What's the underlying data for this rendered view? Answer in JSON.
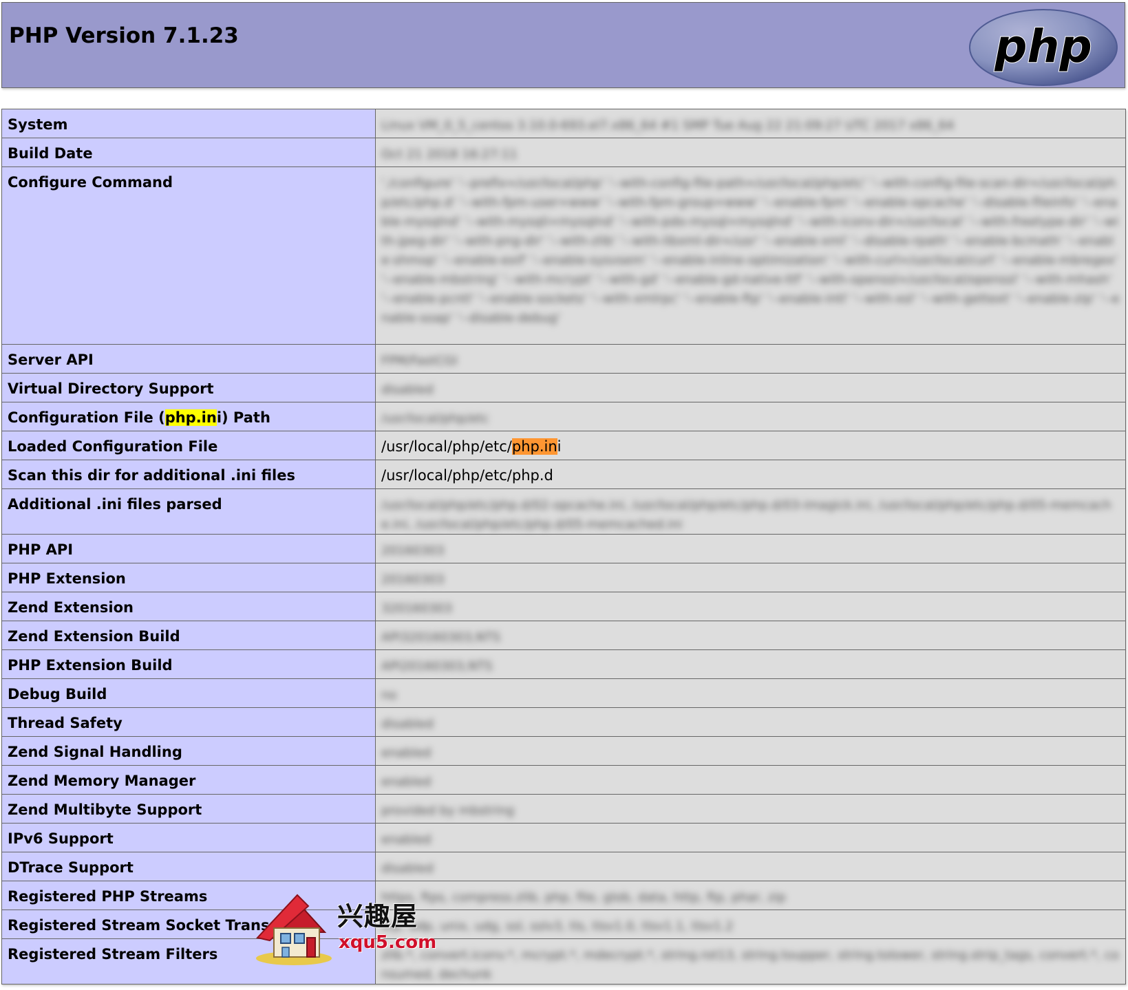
{
  "header": {
    "title": "PHP Version 7.1.23",
    "logo_text": "php",
    "logo_color": "#6f7fba"
  },
  "rows": [
    {
      "label": "System",
      "value": "Linux VM_0_5_centos 3.10.0-693.el7.x86_64 #1 SMP Tue Aug 22 21:09:27 UTC 2017 x86_64",
      "blurred": true
    },
    {
      "label": "Build Date",
      "value": "Oct 21 2018 16:27:11",
      "blurred": true
    },
    {
      "label": "Configure Command",
      "value": "'./configure' '--prefix=/usr/local/php' '--with-config-file-path=/usr/local/php/etc' '--with-config-file-scan-dir=/usr/local/php/etc/php.d' '--with-fpm-user=www' '--with-fpm-group=www' '--enable-fpm' '--enable-opcache' '--disable-fileinfo' '--enable-mysqlnd' '--with-mysqli=mysqlnd' '--with-pdo-mysql=mysqlnd' '--with-iconv-dir=/usr/local' '--with-freetype-dir' '--with-jpeg-dir' '--with-png-dir' '--with-zlib' '--with-libxml-dir=/usr' '--enable-xml' '--disable-rpath' '--enable-bcmath' '--enable-shmop' '--enable-exif' '--enable-sysvsem' '--enable-inline-optimization' '--with-curl=/usr/local/curl' '--enable-mbregex' '--enable-mbstring' '--with-mcrypt' '--with-gd' '--enable-gd-native-ttf' '--with-openssl=/usr/local/openssl' '--with-mhash' '--enable-pcntl' '--enable-sockets' '--with-xmlrpc' '--enable-ftp' '--enable-intl' '--with-xsl' '--with-gettext' '--enable-zip' '--enable-soap' '--disable-debug'",
      "blurred": true
    },
    {
      "label": "Server API",
      "value": "FPM/FastCGI",
      "blurred": true
    },
    {
      "label": "Virtual Directory Support",
      "value": "disabled",
      "blurred": true
    },
    {
      "label_pre": "Configuration File (",
      "label_hl": "php.in",
      "label_post": "i) Path",
      "value": "/usr/local/php/etc",
      "blurred": true
    },
    {
      "label": "Loaded Configuration File",
      "value_pre": "/usr/local/php/etc/",
      "value_hl": "php.in",
      "value_post": "i",
      "blurred": false
    },
    {
      "label": "Scan this dir for additional .ini files",
      "value": "/usr/local/php/etc/php.d",
      "blurred": false
    },
    {
      "label": "Additional .ini files parsed",
      "value": "/usr/local/php/etc/php.d/02-opcache.ini, /usr/local/php/etc/php.d/03-imagick.ini, /usr/local/php/etc/php.d/05-memcache.ini, /usr/local/php/etc/php.d/05-memcached.ini",
      "blurred": true
    },
    {
      "label": "PHP API",
      "value": "20160303",
      "blurred": true
    },
    {
      "label": "PHP Extension",
      "value": "20160303",
      "blurred": true
    },
    {
      "label": "Zend Extension",
      "value": "320160303",
      "blurred": true
    },
    {
      "label": "Zend Extension Build",
      "value": "API320160303,NTS",
      "blurred": true
    },
    {
      "label": "PHP Extension Build",
      "value": "API20160303,NTS",
      "blurred": true
    },
    {
      "label": "Debug Build",
      "value": "no",
      "blurred": true
    },
    {
      "label": "Thread Safety",
      "value": "disabled",
      "blurred": true
    },
    {
      "label": "Zend Signal Handling",
      "value": "enabled",
      "blurred": true
    },
    {
      "label": "Zend Memory Manager",
      "value": "enabled",
      "blurred": true
    },
    {
      "label": "Zend Multibyte Support",
      "value": "provided by mbstring",
      "blurred": true
    },
    {
      "label": "IPv6 Support",
      "value": "enabled",
      "blurred": true
    },
    {
      "label": "DTrace Support",
      "value": "disabled",
      "blurred": true
    },
    {
      "label": "Registered PHP Streams",
      "value": "https, ftps, compress.zlib, php, file, glob, data, http, ftp, phar, zip",
      "blurred": true
    },
    {
      "label": "Registered Stream Socket Transports",
      "value": "tcp, udp, unix, udg, ssl, sslv3, tls, tlsv1.0, tlsv1.1, tlsv1.2",
      "blurred": true
    },
    {
      "label": "Registered Stream Filters",
      "value": "zlib.*, convert.iconv.*, mcrypt.*, mdecrypt.*, string.rot13, string.toupper, string.tolower, string.strip_tags, convert.*, consumed, dechunk",
      "blurred": true
    }
  ],
  "watermark": {
    "cn_text": "兴趣屋",
    "en_text": "xqu5.com"
  }
}
